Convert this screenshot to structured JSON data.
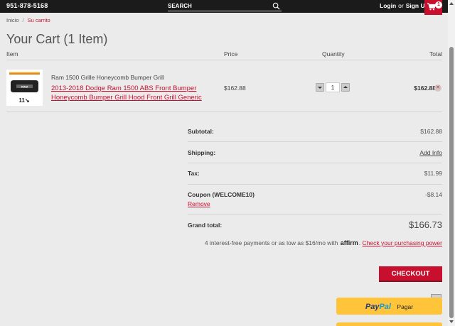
{
  "header": {
    "phone": "951-878-5168",
    "search_placeholder": "SEARCH",
    "login_label": "Login",
    "or_label": "or",
    "signup_label": "Sign Up",
    "cart_count": "1"
  },
  "breadcrumb": {
    "home": "Inicio",
    "separator": "/",
    "current": "Su carrito"
  },
  "page_title": "Your Cart (1 Item)",
  "table": {
    "headers": {
      "item": "Item",
      "price": "Price",
      "quantity": "Quantity",
      "total": "Total"
    },
    "items": [
      {
        "name": "Ram 1500 Grille Honeycomb Bumper Grill",
        "link_text": "2013-2018 Dodge Ram 1500 ABS Front Bumper Honeycomb Bumper Grill Hood Front Grill Generic",
        "price": "$162.88",
        "quantity": "1",
        "total": "$162.88",
        "thumb_text": "11↘"
      }
    ]
  },
  "summary": {
    "subtotal_label": "Subtotal:",
    "subtotal_value": "$162.88",
    "shipping_label": "Shipping:",
    "shipping_link": "Add Info",
    "tax_label": "Tax:",
    "tax_value": "$11.99",
    "coupon_label": "Coupon (WELCOME10)",
    "coupon_value": "-$8.14",
    "coupon_remove": "Remove",
    "grand_total_label": "Grand total:",
    "grand_total_value": "$166.73"
  },
  "affirm": {
    "text": "4 interest-free payments or as low as $16/mo with",
    "logo": "affirm",
    "link": "Check your purchasing power"
  },
  "checkout_label": "CHECKOUT",
  "paypal": {
    "pay": "Pay",
    "pal": "Pal",
    "label": "Pagar"
  },
  "colors": {
    "accent": "#c8102e",
    "topbar": "#1b1b1b",
    "paypal_yellow": "#ffc439"
  }
}
